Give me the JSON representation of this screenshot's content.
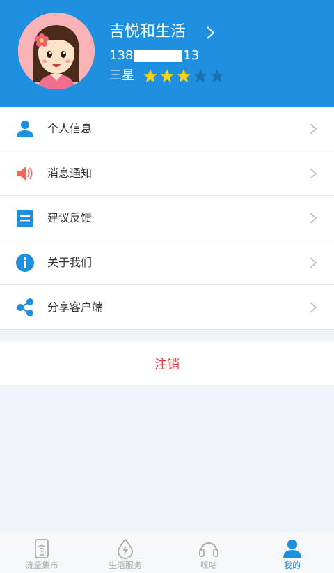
{
  "profile": {
    "username": "吉悦和生活",
    "phone_prefix": "138",
    "phone_suffix": "13",
    "level_label": "三星",
    "stars_filled": 3,
    "stars_total": 5
  },
  "menu": {
    "items": [
      {
        "label": "个人信息",
        "icon": "person-icon"
      },
      {
        "label": "消息通知",
        "icon": "speaker-icon"
      },
      {
        "label": "建议反馈",
        "icon": "feedback-icon"
      },
      {
        "label": "关于我们",
        "icon": "info-icon"
      },
      {
        "label": "分享客户端",
        "icon": "share-icon"
      }
    ]
  },
  "logout": {
    "label": "注销"
  },
  "tabbar": {
    "tabs": [
      {
        "label": "流量集市",
        "icon": "phone-wifi-icon",
        "active": false
      },
      {
        "label": "生活服务",
        "icon": "lightning-drop-icon",
        "active": false
      },
      {
        "label": "咪咕",
        "icon": "headphones-icon",
        "active": false
      },
      {
        "label": "我的",
        "icon": "person-icon",
        "active": true
      }
    ]
  },
  "colors": {
    "header_bg": "#1f8fe0",
    "accent": "#1f8fe0",
    "star_filled": "#f5d31a",
    "star_empty": "#1a6fb3",
    "logout_text": "#e23b3b",
    "page_bg": "#eff4fb"
  }
}
